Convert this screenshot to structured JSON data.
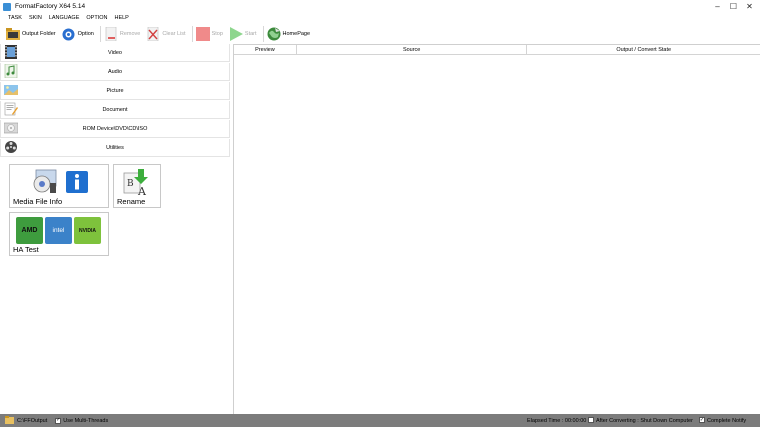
{
  "window": {
    "title": "FormatFactory X64 5.14"
  },
  "menu": [
    "TASK",
    "SKIN",
    "LANGUAGE",
    "OPTION",
    "HELP"
  ],
  "toolbar": {
    "output_folder": "Output Folder",
    "option": "Option",
    "remove": "Remove",
    "clear_list": "Clear List",
    "stop": "Stop",
    "start": "Start",
    "homepage": "HomePage"
  },
  "categories": [
    "Video",
    "Audio",
    "Picture",
    "Document",
    "ROM Device\\DVD\\CD\\ISO",
    "Utilities"
  ],
  "tiles": {
    "media_file_info": "Media File Info",
    "rename": "Rename",
    "ha_test": "HA Test",
    "amd": "AMD",
    "intel": "intel",
    "nvidia": "NVIDIA"
  },
  "table": {
    "columns": [
      "Preview",
      "Source",
      "Output / Convert State"
    ]
  },
  "status": {
    "output_path": "C:\\FFOutput",
    "use_multi_threads": "Use Multi-Threads",
    "use_multi_threads_checked": true,
    "elapsed": "Elapsed Time : 00:00:00",
    "after_converting": "After Converting : Shut Down Computer",
    "after_converting_checked": false,
    "complete_notify": "Complete Notify",
    "complete_notify_checked": true
  },
  "colors": {
    "status_bar": "#7c7c7c",
    "start_green": "#5cc35c",
    "stop_red": "#e86a6a"
  }
}
